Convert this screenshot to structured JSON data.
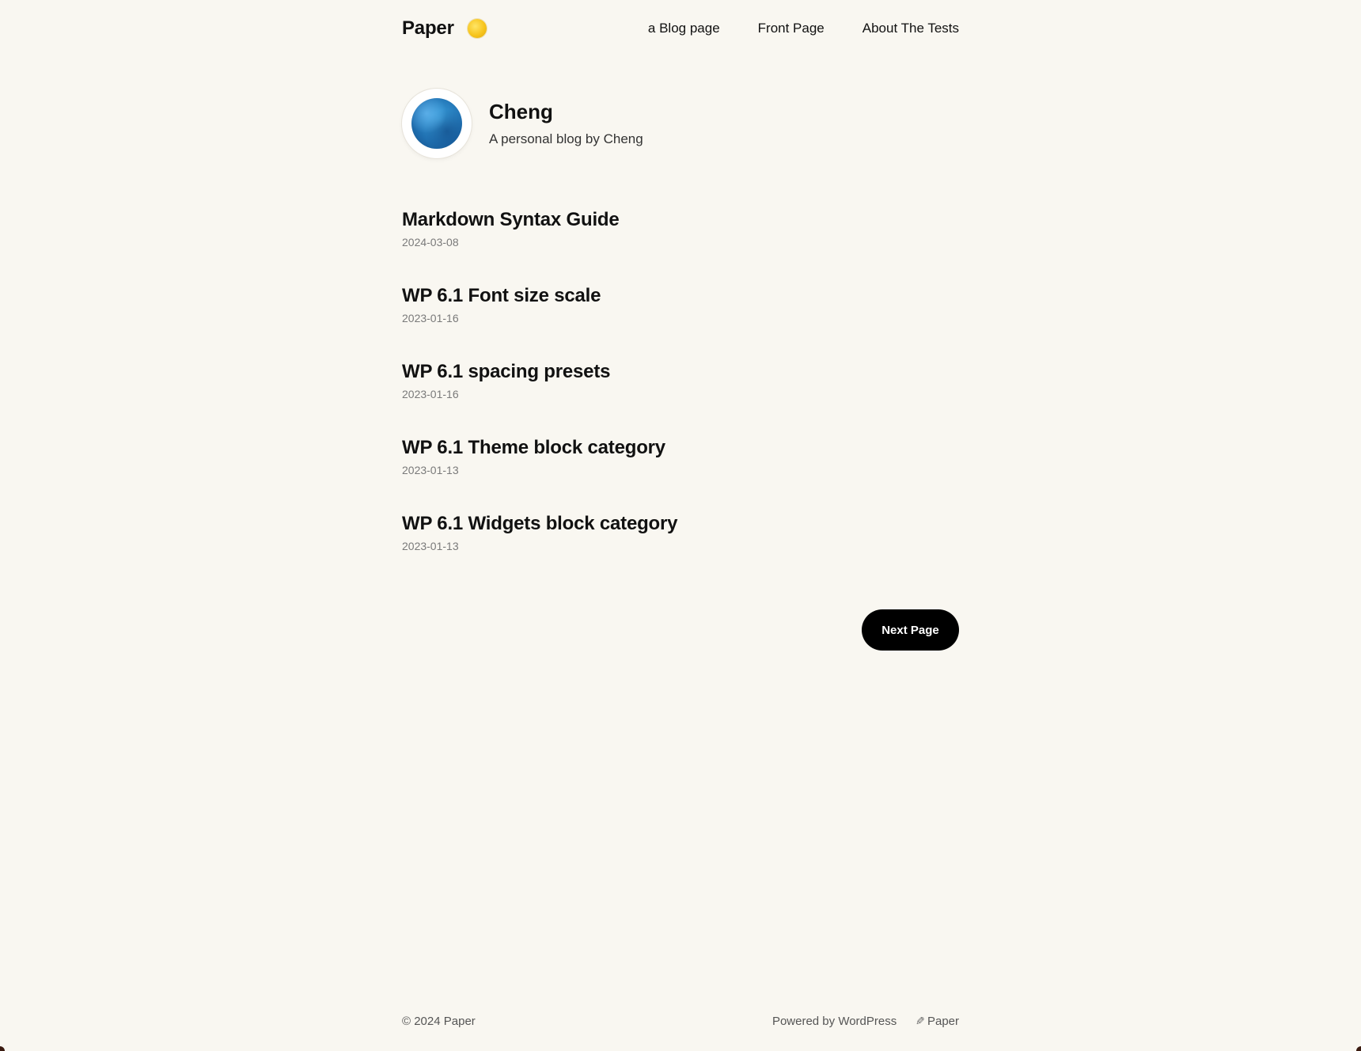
{
  "header": {
    "site_title": "Paper",
    "theme_toggle_icon": "sun-icon",
    "nav": [
      {
        "label": "a Blog page"
      },
      {
        "label": "Front Page"
      },
      {
        "label": "About The Tests"
      }
    ]
  },
  "profile": {
    "name": "Cheng",
    "tagline": "A personal blog by Cheng"
  },
  "posts": [
    {
      "title": "Markdown Syntax Guide",
      "date": "2024-03-08"
    },
    {
      "title": "WP 6.1 Font size scale",
      "date": "2023-01-16"
    },
    {
      "title": "WP 6.1 spacing presets",
      "date": "2023-01-16"
    },
    {
      "title": "WP 6.1 Theme block category",
      "date": "2023-01-13"
    },
    {
      "title": "WP 6.1 Widgets block category",
      "date": "2023-01-13"
    }
  ],
  "pagination": {
    "next_label": "Next Page"
  },
  "footer": {
    "copyright": "© 2024 Paper",
    "powered_by": "Powered by WordPress",
    "theme_icon": "pencil-icon",
    "theme_name": "Paper"
  },
  "colors": {
    "background": "#f9f7f1",
    "text": "#111111",
    "muted": "#7a7a7a",
    "button": "#000000"
  }
}
